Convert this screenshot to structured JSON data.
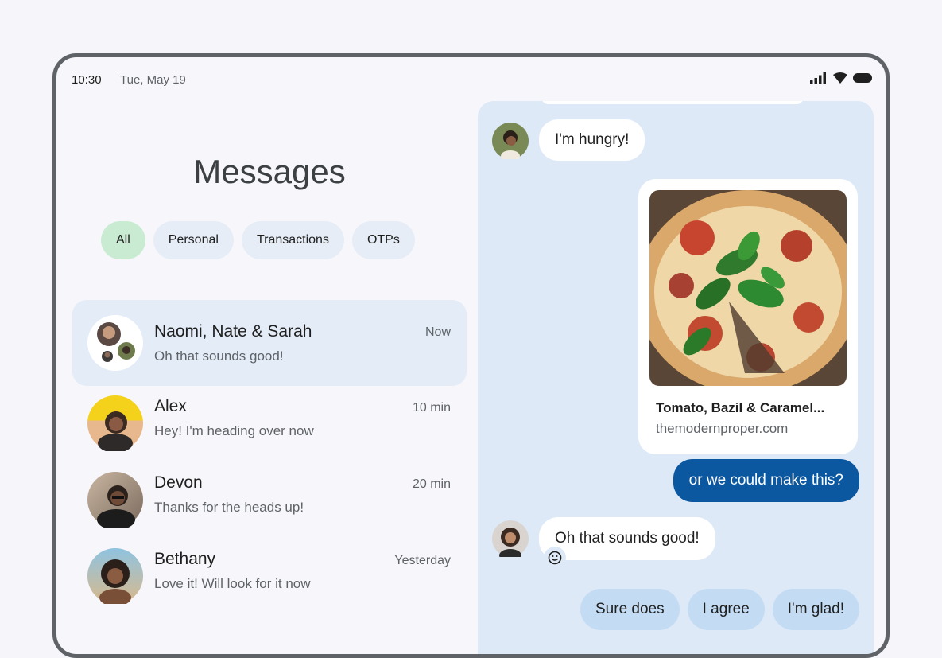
{
  "status_bar": {
    "time": "10:30",
    "date": "Tue, May 19"
  },
  "header": {
    "title": "Messages"
  },
  "filters": [
    {
      "label": "All",
      "active": true
    },
    {
      "label": "Personal",
      "active": false
    },
    {
      "label": "Transactions",
      "active": false
    },
    {
      "label": "OTPs",
      "active": false
    }
  ],
  "conversations": [
    {
      "name": "Naomi, Nate & Sarah",
      "preview": "Oh that sounds good!",
      "time": "Now",
      "selected": true
    },
    {
      "name": "Alex",
      "preview": "Hey! I'm heading over now",
      "time": "10 min",
      "selected": false
    },
    {
      "name": "Devon",
      "preview": "Thanks for the heads up!",
      "time": "20 min",
      "selected": false
    },
    {
      "name": "Bethany",
      "preview": "Love it! Will look for it now",
      "time": "Yesterday",
      "selected": false
    }
  ],
  "chat": {
    "messages": [
      {
        "type": "incoming",
        "text": "I'm hungry!"
      },
      {
        "type": "link_card",
        "title": "Tomato, Bazil & Caramel...",
        "domain": "themodernproper.com"
      },
      {
        "type": "outgoing",
        "text": "or we could make this?"
      },
      {
        "type": "incoming",
        "text": "Oh that sounds good!"
      }
    ],
    "smart_replies": [
      "Sure does",
      "I agree",
      "I'm glad!"
    ]
  },
  "colors": {
    "accent_outgoing": "#0b57a0",
    "chat_background": "#dde9f6",
    "chip_active": "#c8ebd1",
    "chip": "#e6edf6",
    "smart_reply": "#c3dcf3"
  },
  "icons": [
    "signal-icon",
    "wifi-icon",
    "battery-icon",
    "smiley-reaction-icon"
  ]
}
